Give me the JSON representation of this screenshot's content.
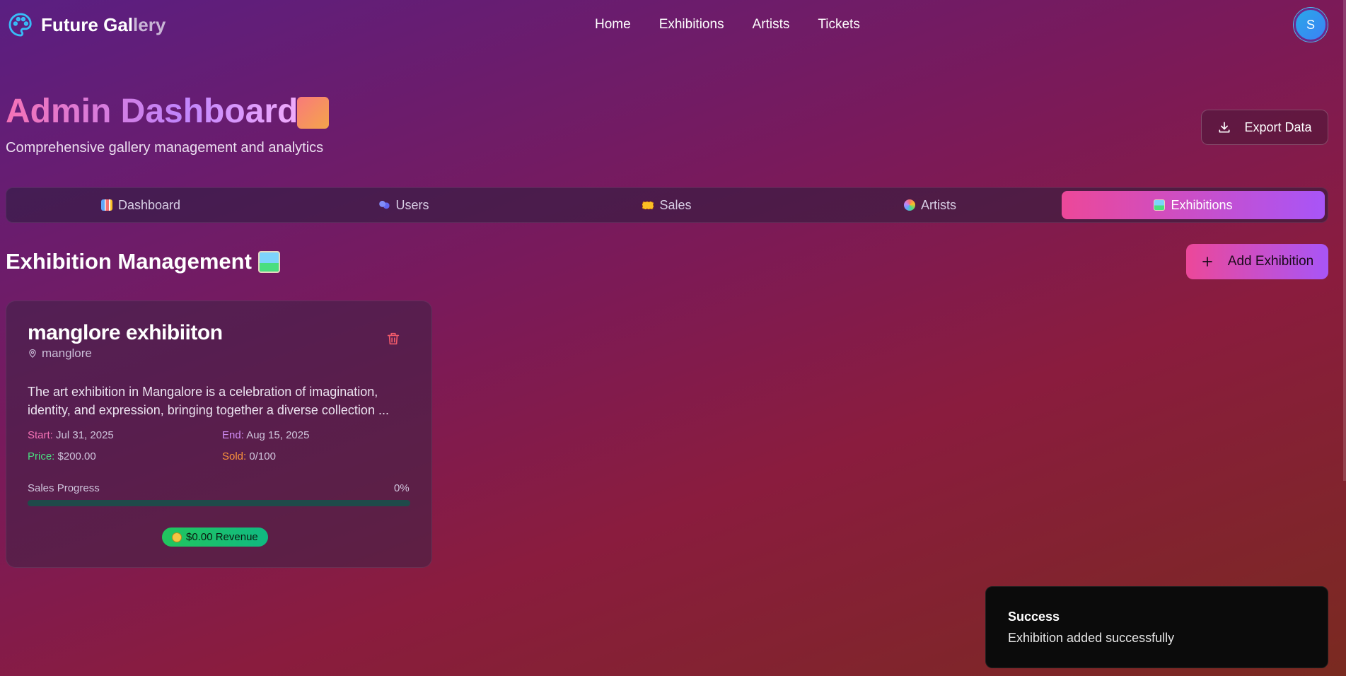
{
  "nav": {
    "brand": "Future Gal",
    "brand_dim": "lery",
    "links": [
      "Home",
      "Exhibitions",
      "Artists",
      "Tickets"
    ],
    "avatar_initial": "S"
  },
  "header": {
    "title": "Admin Dashboard",
    "subtitle": "Comprehensive gallery management and analytics",
    "export_label": "Export Data"
  },
  "tabs": [
    {
      "label": "Dashboard",
      "icon": "bar-chart-icon",
      "active": false
    },
    {
      "label": "Users",
      "icon": "users-icon",
      "active": false
    },
    {
      "label": "Sales",
      "icon": "ticket-icon",
      "active": false
    },
    {
      "label": "Artists",
      "icon": "palette-icon",
      "active": false
    },
    {
      "label": "Exhibitions",
      "icon": "picture-icon",
      "active": true
    }
  ],
  "section": {
    "title": "Exhibition Management",
    "add_label": "Add Exhibition"
  },
  "exhibition": {
    "title": "manglore exhibiiton",
    "location": "manglore",
    "description": "The art exhibition in Mangalore is a celebration of imagination, identity, and expression, bringing together a diverse collection ...",
    "start_label": "Start:",
    "start_value": "Jul 31, 2025",
    "end_label": "End:",
    "end_value": "Aug 15, 2025",
    "price_label": "Price:",
    "price_value": "$200.00",
    "sold_label": "Sold:",
    "sold_value": "0/100",
    "progress_label": "Sales Progress",
    "progress_pct": "0%",
    "progress_fraction": 0,
    "revenue": "$0.00 Revenue"
  },
  "toast": {
    "title": "Success",
    "message": "Exhibition added successfully"
  },
  "colors": {
    "accent_pink": "#ec4899",
    "accent_purple": "#a855f7",
    "success_green": "#22c55e"
  }
}
